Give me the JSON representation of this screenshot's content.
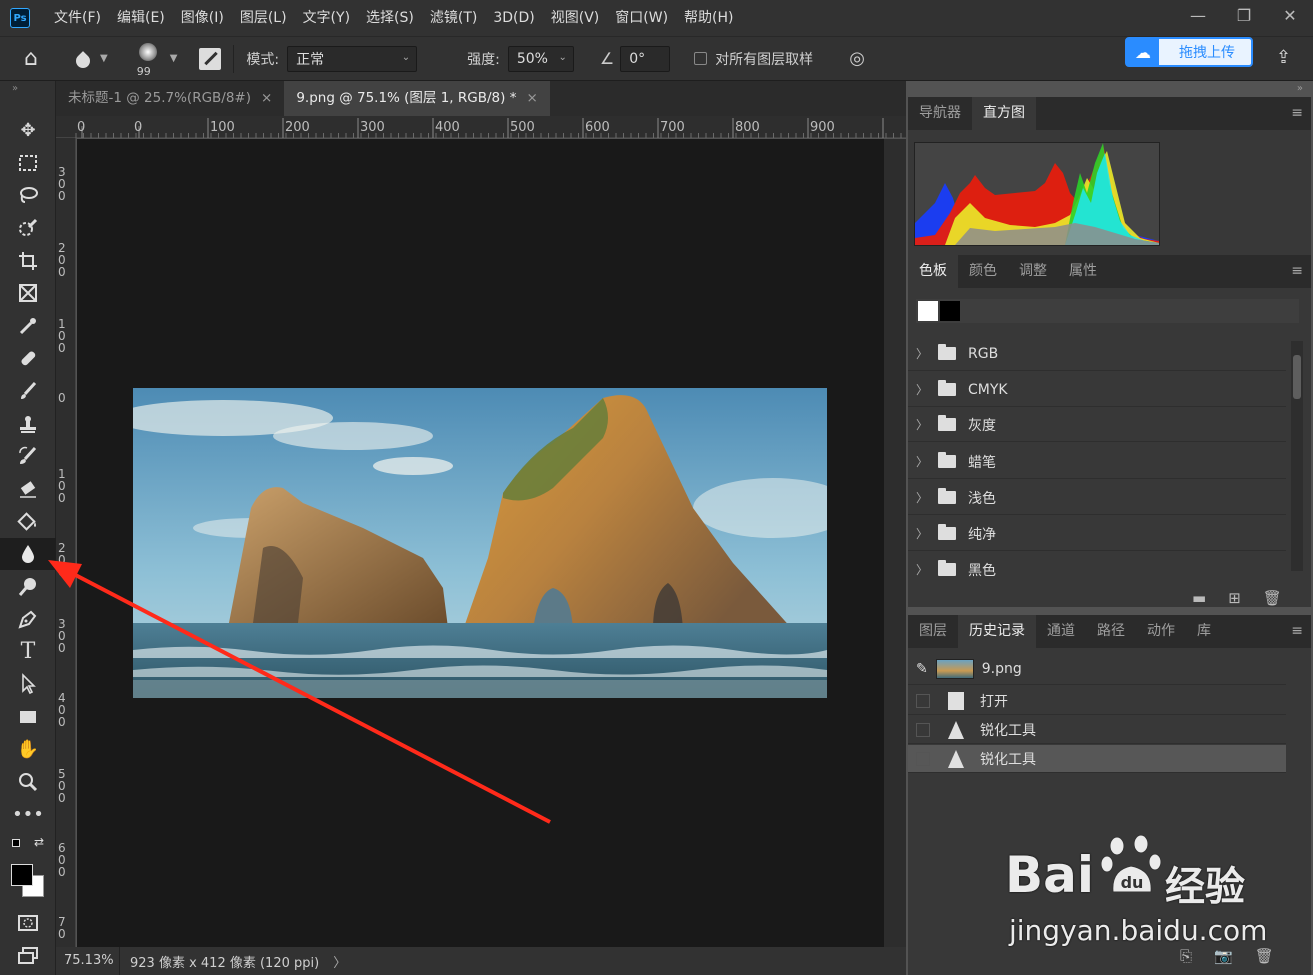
{
  "app": {
    "logo": "Ps"
  },
  "menu": [
    "文件(F)",
    "编辑(E)",
    "图像(I)",
    "图层(L)",
    "文字(Y)",
    "选择(S)",
    "滤镜(T)",
    "3D(D)",
    "视图(V)",
    "窗口(W)",
    "帮助(H)"
  ],
  "window_controls": {
    "minimize": "—",
    "restore": "❐",
    "close": "✕"
  },
  "options": {
    "brush_size": "99",
    "mode_label": "模式:",
    "mode_value": "正常",
    "strength_label": "强度:",
    "strength_value": "50%",
    "angle_value": "0°",
    "sample_all_label": "对所有图层取样",
    "upload_label": "拖拽上传"
  },
  "doc_tabs": [
    {
      "label": "未标题-1 @ 25.7%(RGB/8#)",
      "close": "×"
    },
    {
      "label": "9.png @ 75.1% (图层 1, RGB/8) *",
      "close": "×"
    }
  ],
  "ruler_top": [
    "0",
    "0",
    "100",
    "200",
    "300",
    "400",
    "500",
    "600",
    "700",
    "800",
    "900"
  ],
  "ruler_left": [
    "3\n0\n0",
    "2\n0\n0",
    "1\n0\n0",
    "0",
    "1\n0\n0",
    "2\n0\n0",
    "3\n0\n0",
    "4\n0\n0",
    "5\n0\n0",
    "6\n0\n0",
    "7\n0"
  ],
  "status": {
    "zoom": "75.13%",
    "info": "923 像素 x 412 像素 (120 ppi)",
    "arrow": "〉"
  },
  "histogram_panel": {
    "tabs": [
      "导航器",
      "直方图"
    ],
    "active": 1
  },
  "swatches_panel": {
    "tabs": [
      "色板",
      "颜色",
      "调整",
      "属性"
    ],
    "active": 0,
    "folders": [
      "RGB",
      "CMYK",
      "灰度",
      "蜡笔",
      "浅色",
      "纯净",
      "黑色"
    ]
  },
  "history_panel": {
    "tabs": [
      "图层",
      "历史记录",
      "通道",
      "路径",
      "动作",
      "库"
    ],
    "active": 1,
    "snapshot": "9.png",
    "items": [
      "打开",
      "锐化工具",
      "锐化工具"
    ]
  },
  "watermark": {
    "text1": "Bai",
    "text2": "经验",
    "url": "jingyan.baidu.com"
  },
  "colors": {
    "accent": "#31a8ff",
    "arrow": "#ff2a1a"
  }
}
